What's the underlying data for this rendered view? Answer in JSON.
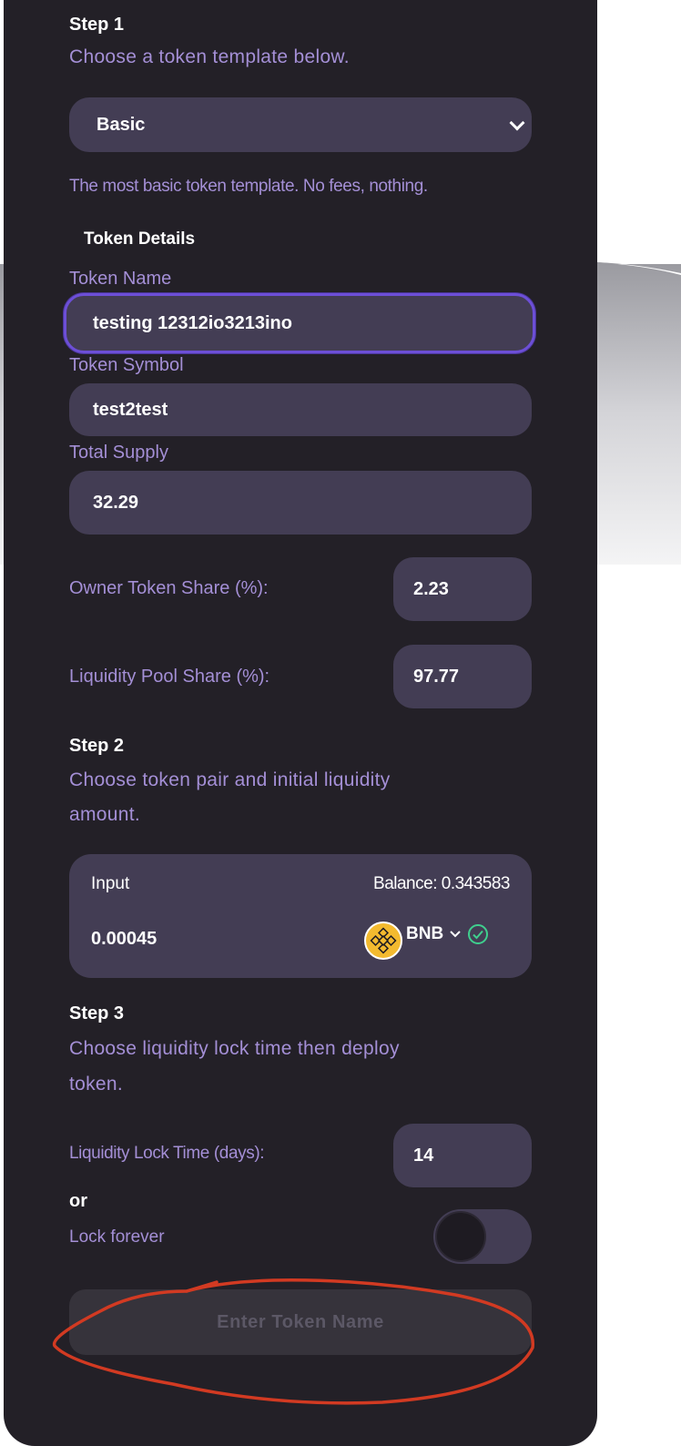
{
  "step1": {
    "title": "Step 1",
    "description": "Choose a token template below.",
    "template_selected": "Basic",
    "template_description": "The most basic token template. No fees, nothing."
  },
  "token_details": {
    "heading": "Token Details",
    "name_label": "Token Name",
    "name_value": "testing 12312io3213ino",
    "symbol_label": "Token Symbol",
    "symbol_value": "test2test",
    "supply_label": "Total Supply",
    "supply_value": "32.29",
    "owner_share_label": "Owner Token Share (%):",
    "owner_share_value": "2.23",
    "lp_share_label": "Liquidity Pool Share (%):",
    "lp_share_value": "97.77"
  },
  "step2": {
    "title": "Step 2",
    "description_line1": "Choose token pair and initial liquidity",
    "description_line2": "amount.",
    "input_label": "Input",
    "balance": "Balance: 0.343583",
    "amount": "0.00045",
    "token": "BNB"
  },
  "step3": {
    "title": "Step 3",
    "description_line1": "Choose liquidity lock time then deploy",
    "description_line2": "token.",
    "lock_time_label": "Liquidity Lock Time (days):",
    "lock_time_value": "14",
    "or_text": "or",
    "lock_forever_label": "Lock forever",
    "lock_forever_on": false
  },
  "deploy_button_label": "Enter Token Name",
  "colors": {
    "card_bg": "#232027",
    "field_bg": "#433d54",
    "accent_purple": "#a48fd6",
    "focus_border": "#6d4fd7",
    "annotation_red": "#d23a22",
    "bnb_yellow": "#f3ba2f",
    "check_green": "#3fcf8e"
  }
}
